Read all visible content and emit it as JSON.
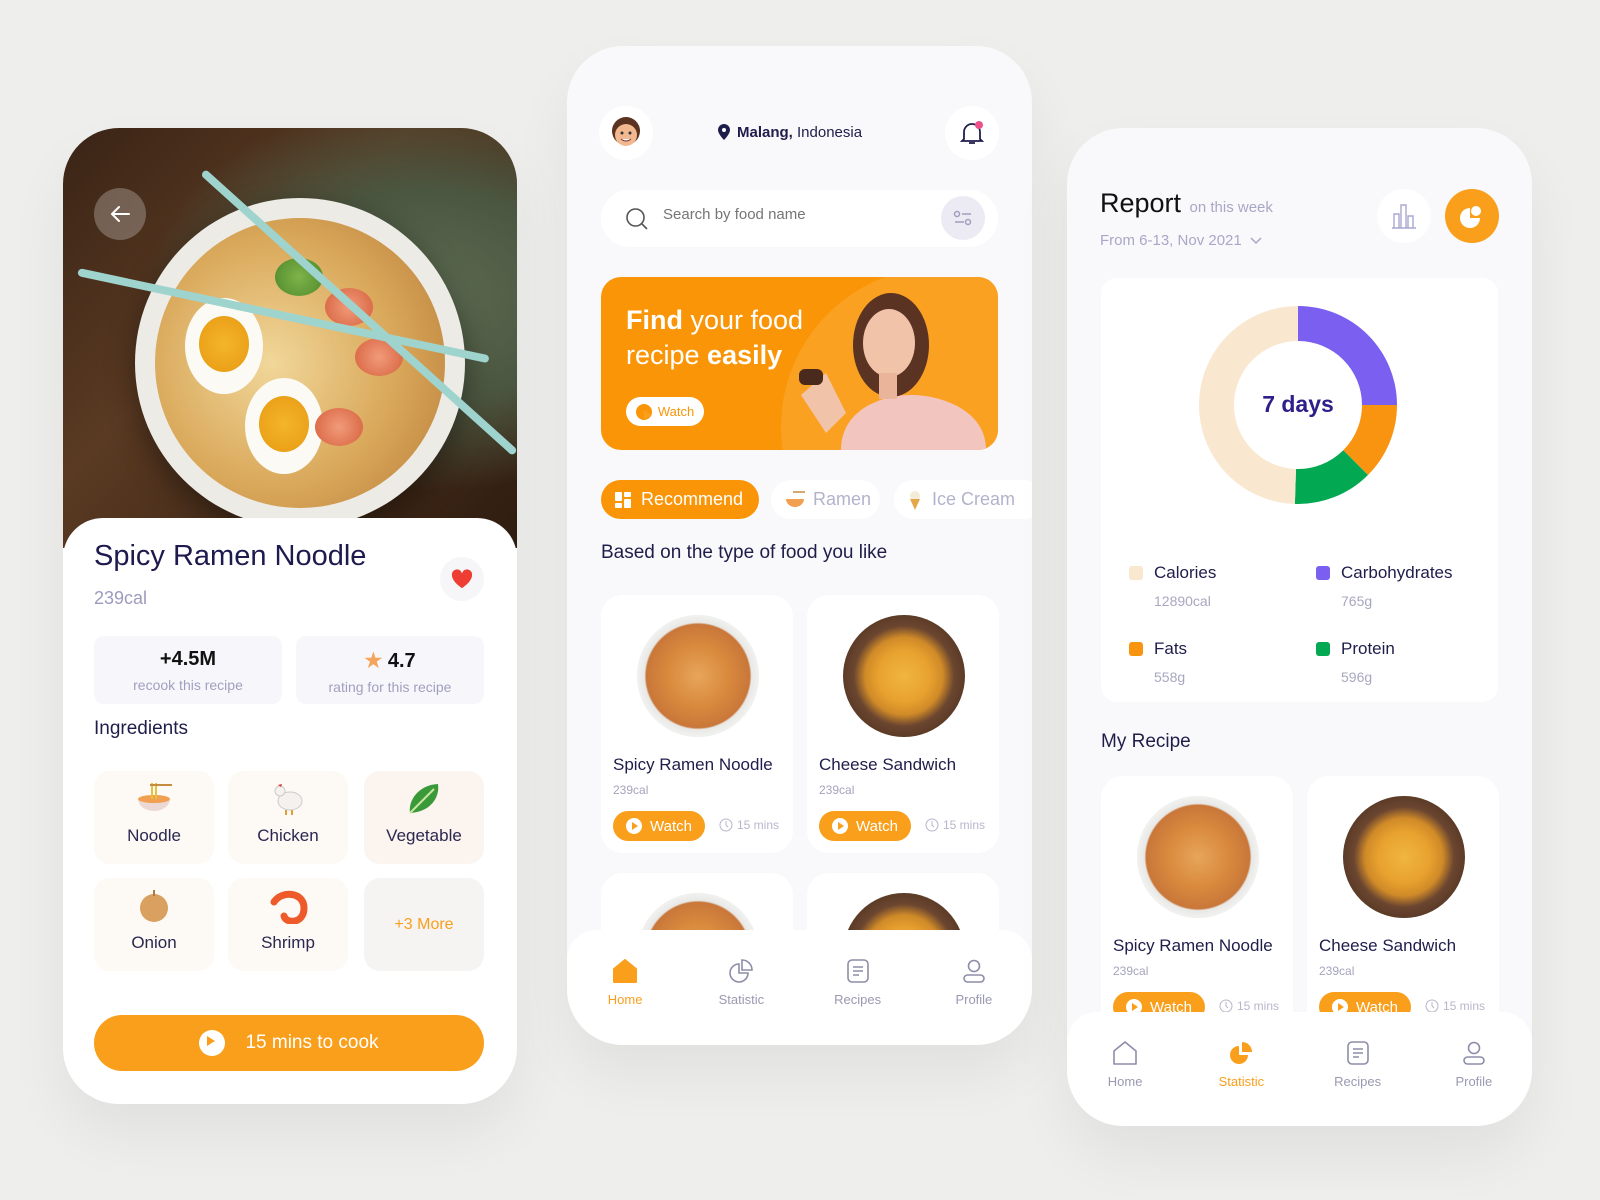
{
  "colors": {
    "accent": "#f99f1c",
    "navy": "#1f1d4a",
    "heart": "#ee3d33"
  },
  "detail": {
    "back_icon": "arrow-left-icon",
    "title": "Spicy Ramen Noodle",
    "calories": "239cal",
    "stats": [
      {
        "value": "+4.5M",
        "label": "recook this recipe"
      },
      {
        "value": "4.7",
        "label": "rating for this recipe"
      }
    ],
    "ingredients_title": "Ingredients",
    "ingredients": [
      {
        "name": "Noodle"
      },
      {
        "name": "Chicken"
      },
      {
        "name": "Vegetable"
      },
      {
        "name": "Onion"
      },
      {
        "name": "Shrimp"
      }
    ],
    "more": "+3 More",
    "cook_button": "15 mins to cook"
  },
  "home": {
    "location_city": "Malang,",
    "location_country": " Indonesia",
    "search_placeholder": "Search by food name",
    "banner": {
      "bold1": "Find",
      "text1": " your food",
      "text2": "recipe ",
      "bold2": "easily",
      "watch": "Watch"
    },
    "chips": [
      {
        "label": "Recommend"
      },
      {
        "label": "Ramen"
      },
      {
        "label": "Ice Cream"
      }
    ],
    "section_title": "Based on the type of food you like",
    "cards": [
      {
        "name": "Spicy Ramen Noodle",
        "cal": "239cal",
        "watch": "Watch",
        "time": "15 mins"
      },
      {
        "name": "Cheese Sandwich",
        "cal": "239cal",
        "watch": "Watch",
        "time": "15 mins"
      }
    ],
    "nav": [
      {
        "label": "Home"
      },
      {
        "label": "Statistic"
      },
      {
        "label": "Recipes"
      },
      {
        "label": "Profile"
      }
    ]
  },
  "report": {
    "title": "Report",
    "subtitle": "on this week",
    "date_range": "From 6-13, Nov 2021",
    "my_recipe_title": "My Recipe",
    "cards": [
      {
        "name": "Spicy Ramen Noodle",
        "cal": "239cal",
        "watch": "Watch",
        "time": "15 mins"
      },
      {
        "name": "Cheese Sandwich",
        "cal": "239cal",
        "watch": "Watch",
        "time": "15 mins"
      }
    ],
    "nav": [
      {
        "label": "Home"
      },
      {
        "label": "Statistic"
      },
      {
        "label": "Recipes"
      },
      {
        "label": "Profile"
      }
    ]
  },
  "chart_data": {
    "type": "pie",
    "center_label": "7 days",
    "series": [
      {
        "name": "Carbohydrates",
        "value": "765g",
        "share": 25,
        "color": "#7b5ff0"
      },
      {
        "name": "Fats",
        "value": "558g",
        "share": 12.5,
        "color": "#f99410"
      },
      {
        "name": "Protein",
        "value": "596g",
        "share": 13,
        "color": "#03a852"
      },
      {
        "name": "Calories",
        "value": "12890cal",
        "share": 49.5,
        "color": "#f9e8cf"
      }
    ]
  }
}
